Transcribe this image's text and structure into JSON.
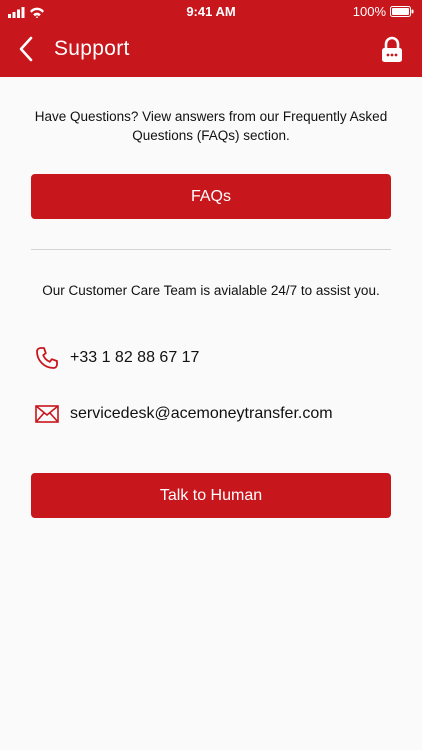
{
  "status_bar": {
    "time": "9:41 AM",
    "battery": "100%"
  },
  "header": {
    "title": "Support"
  },
  "faq_section": {
    "description": "Have Questions? View answers from our Frequently Asked Questions (FAQs) section.",
    "button_label": "FAQs"
  },
  "care_section": {
    "description": "Our Customer Care Team is avialable 24/7 to assist you.",
    "phone": "+33 1 82 88 67 17",
    "email": "servicedesk@acemoneytransfer.com",
    "button_label": "Talk to Human"
  },
  "icons": {
    "back": "chevron-left-icon",
    "lock": "lock-icon",
    "phone": "phone-icon",
    "email": "envelope-icon"
  },
  "colors": {
    "brand": "#c8161d",
    "background": "#fafafa"
  }
}
